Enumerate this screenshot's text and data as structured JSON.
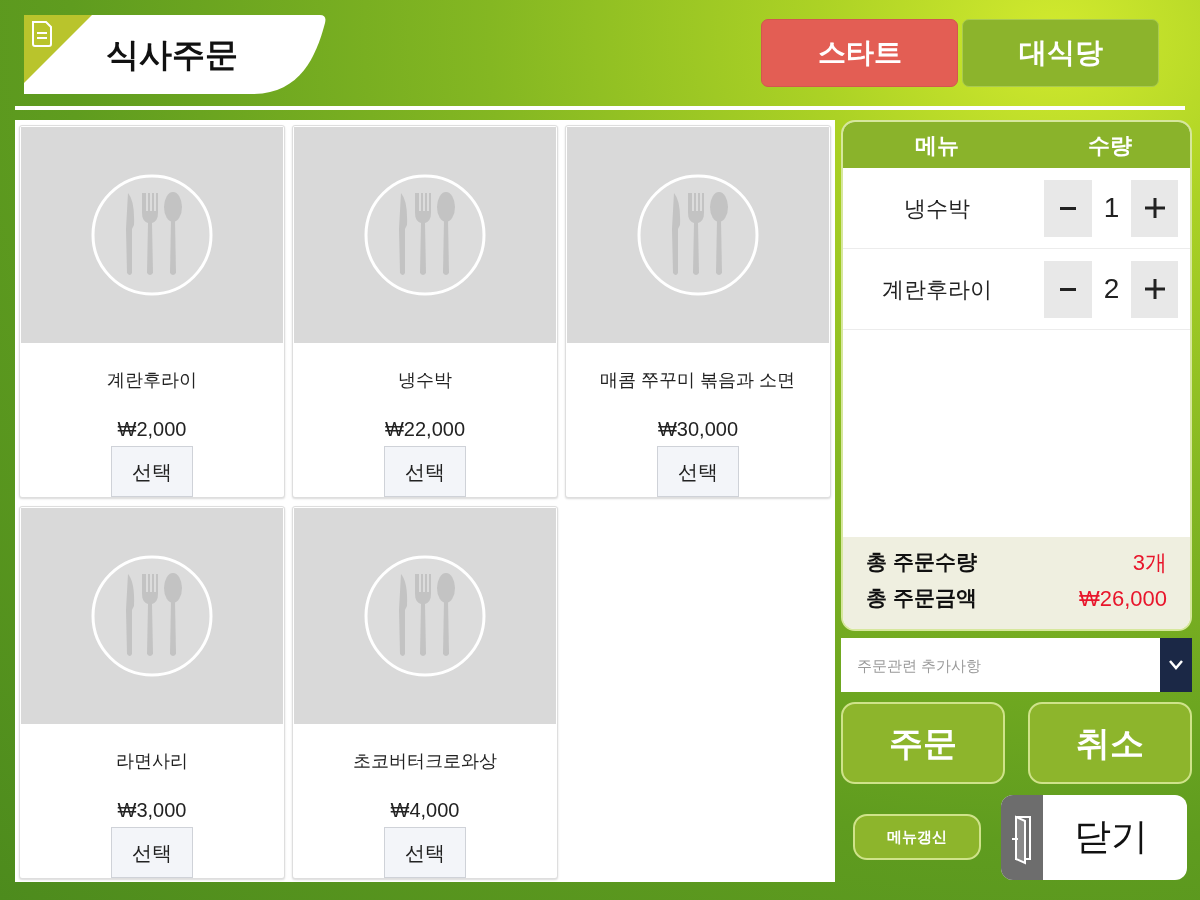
{
  "header": {
    "title": "식사주문"
  },
  "venue_tabs": [
    {
      "label": "스타트",
      "selected": true
    },
    {
      "label": "대식당",
      "selected": false
    }
  ],
  "menu_items": [
    {
      "name": "계란후라이",
      "price": "₩2,000",
      "button": "선택"
    },
    {
      "name": "냉수박",
      "price": "₩22,000",
      "button": "선택"
    },
    {
      "name": "매콤 쭈꾸미 볶음과 소면",
      "price": "₩30,000",
      "button": "선택"
    },
    {
      "name": "라면사리",
      "price": "₩3,000",
      "button": "선택"
    },
    {
      "name": "초코버터크로와상",
      "price": "₩4,000",
      "button": "선택"
    }
  ],
  "order": {
    "columns": [
      "메뉴",
      "수량"
    ],
    "items": [
      {
        "name": "냉수박",
        "quantity": "1"
      },
      {
        "name": "계란후라이",
        "quantity": "2"
      }
    ],
    "summary": [
      {
        "label": "총 주문수량",
        "value": "3개"
      },
      {
        "label": "총 주문금액",
        "value": "₩26,000"
      }
    ]
  },
  "request_field": {
    "placeholder": "주문관련 추가사항"
  },
  "actions": [
    {
      "label": "주문"
    },
    {
      "label": "취소"
    }
  ],
  "refresh_button": {
    "label": "메뉴갱신"
  },
  "close_button": {
    "label": "닫기"
  }
}
